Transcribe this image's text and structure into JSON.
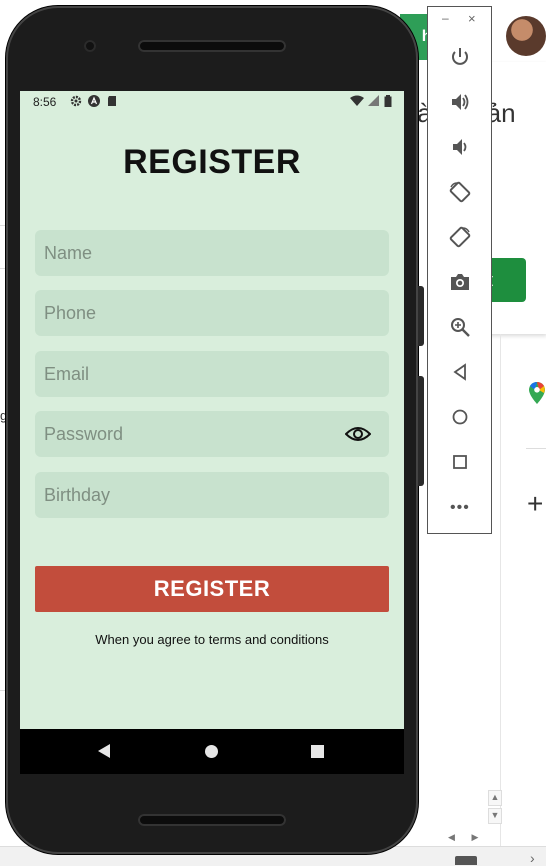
{
  "background_app": {
    "heading_fragment": "tài khoản",
    "tab_fragment": "hi",
    "left_fragment": "g",
    "button_fragment": "t",
    "plus_label": "+"
  },
  "status_bar": {
    "time": "8:56"
  },
  "screen": {
    "title": "REGISTER",
    "fields": [
      {
        "placeholder": "Name"
      },
      {
        "placeholder": "Phone"
      },
      {
        "placeholder": "Email"
      },
      {
        "placeholder": "Password",
        "icon": "eye-icon"
      },
      {
        "placeholder": "Birthday"
      }
    ],
    "register_button": "REGISTER",
    "terms_text": "When you agree to terms and conditions"
  },
  "emulator_toolbar": {
    "minimize": "–",
    "close": "×",
    "buttons": [
      "power-icon",
      "volume-up-icon",
      "volume-down-icon",
      "rotate-left-icon",
      "rotate-right-icon",
      "camera-icon",
      "zoom-icon",
      "back-icon",
      "home-icon",
      "overview-icon",
      "more-icon"
    ],
    "more": "•••"
  },
  "colors": {
    "screen_bg": "#d9eedc",
    "field_bg": "#c8e2ce",
    "button_bg": "#c24d3c",
    "accent_green": "#1e8e3e"
  }
}
